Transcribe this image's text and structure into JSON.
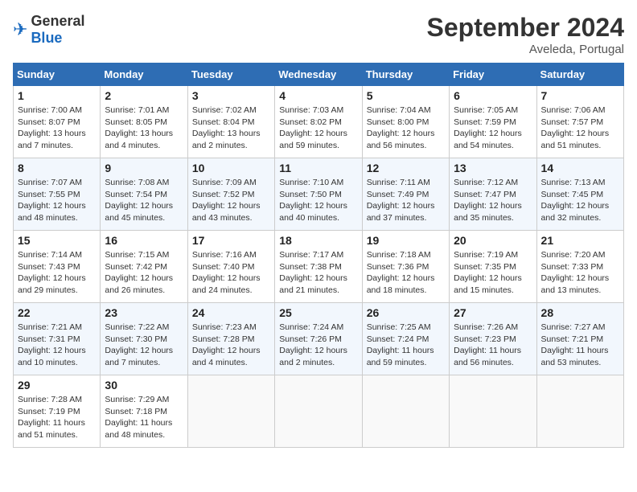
{
  "header": {
    "logo_general": "General",
    "logo_blue": "Blue",
    "month_title": "September 2024",
    "subtitle": "Aveleda, Portugal"
  },
  "days_of_week": [
    "Sunday",
    "Monday",
    "Tuesday",
    "Wednesday",
    "Thursday",
    "Friday",
    "Saturday"
  ],
  "weeks": [
    [
      {
        "day": "1",
        "sunrise": "Sunrise: 7:00 AM",
        "sunset": "Sunset: 8:07 PM",
        "daylight": "Daylight: 13 hours and 7 minutes."
      },
      {
        "day": "2",
        "sunrise": "Sunrise: 7:01 AM",
        "sunset": "Sunset: 8:05 PM",
        "daylight": "Daylight: 13 hours and 4 minutes."
      },
      {
        "day": "3",
        "sunrise": "Sunrise: 7:02 AM",
        "sunset": "Sunset: 8:04 PM",
        "daylight": "Daylight: 13 hours and 2 minutes."
      },
      {
        "day": "4",
        "sunrise": "Sunrise: 7:03 AM",
        "sunset": "Sunset: 8:02 PM",
        "daylight": "Daylight: 12 hours and 59 minutes."
      },
      {
        "day": "5",
        "sunrise": "Sunrise: 7:04 AM",
        "sunset": "Sunset: 8:00 PM",
        "daylight": "Daylight: 12 hours and 56 minutes."
      },
      {
        "day": "6",
        "sunrise": "Sunrise: 7:05 AM",
        "sunset": "Sunset: 7:59 PM",
        "daylight": "Daylight: 12 hours and 54 minutes."
      },
      {
        "day": "7",
        "sunrise": "Sunrise: 7:06 AM",
        "sunset": "Sunset: 7:57 PM",
        "daylight": "Daylight: 12 hours and 51 minutes."
      }
    ],
    [
      {
        "day": "8",
        "sunrise": "Sunrise: 7:07 AM",
        "sunset": "Sunset: 7:55 PM",
        "daylight": "Daylight: 12 hours and 48 minutes."
      },
      {
        "day": "9",
        "sunrise": "Sunrise: 7:08 AM",
        "sunset": "Sunset: 7:54 PM",
        "daylight": "Daylight: 12 hours and 45 minutes."
      },
      {
        "day": "10",
        "sunrise": "Sunrise: 7:09 AM",
        "sunset": "Sunset: 7:52 PM",
        "daylight": "Daylight: 12 hours and 43 minutes."
      },
      {
        "day": "11",
        "sunrise": "Sunrise: 7:10 AM",
        "sunset": "Sunset: 7:50 PM",
        "daylight": "Daylight: 12 hours and 40 minutes."
      },
      {
        "day": "12",
        "sunrise": "Sunrise: 7:11 AM",
        "sunset": "Sunset: 7:49 PM",
        "daylight": "Daylight: 12 hours and 37 minutes."
      },
      {
        "day": "13",
        "sunrise": "Sunrise: 7:12 AM",
        "sunset": "Sunset: 7:47 PM",
        "daylight": "Daylight: 12 hours and 35 minutes."
      },
      {
        "day": "14",
        "sunrise": "Sunrise: 7:13 AM",
        "sunset": "Sunset: 7:45 PM",
        "daylight": "Daylight: 12 hours and 32 minutes."
      }
    ],
    [
      {
        "day": "15",
        "sunrise": "Sunrise: 7:14 AM",
        "sunset": "Sunset: 7:43 PM",
        "daylight": "Daylight: 12 hours and 29 minutes."
      },
      {
        "day": "16",
        "sunrise": "Sunrise: 7:15 AM",
        "sunset": "Sunset: 7:42 PM",
        "daylight": "Daylight: 12 hours and 26 minutes."
      },
      {
        "day": "17",
        "sunrise": "Sunrise: 7:16 AM",
        "sunset": "Sunset: 7:40 PM",
        "daylight": "Daylight: 12 hours and 24 minutes."
      },
      {
        "day": "18",
        "sunrise": "Sunrise: 7:17 AM",
        "sunset": "Sunset: 7:38 PM",
        "daylight": "Daylight: 12 hours and 21 minutes."
      },
      {
        "day": "19",
        "sunrise": "Sunrise: 7:18 AM",
        "sunset": "Sunset: 7:36 PM",
        "daylight": "Daylight: 12 hours and 18 minutes."
      },
      {
        "day": "20",
        "sunrise": "Sunrise: 7:19 AM",
        "sunset": "Sunset: 7:35 PM",
        "daylight": "Daylight: 12 hours and 15 minutes."
      },
      {
        "day": "21",
        "sunrise": "Sunrise: 7:20 AM",
        "sunset": "Sunset: 7:33 PM",
        "daylight": "Daylight: 12 hours and 13 minutes."
      }
    ],
    [
      {
        "day": "22",
        "sunrise": "Sunrise: 7:21 AM",
        "sunset": "Sunset: 7:31 PM",
        "daylight": "Daylight: 12 hours and 10 minutes."
      },
      {
        "day": "23",
        "sunrise": "Sunrise: 7:22 AM",
        "sunset": "Sunset: 7:30 PM",
        "daylight": "Daylight: 12 hours and 7 minutes."
      },
      {
        "day": "24",
        "sunrise": "Sunrise: 7:23 AM",
        "sunset": "Sunset: 7:28 PM",
        "daylight": "Daylight: 12 hours and 4 minutes."
      },
      {
        "day": "25",
        "sunrise": "Sunrise: 7:24 AM",
        "sunset": "Sunset: 7:26 PM",
        "daylight": "Daylight: 12 hours and 2 minutes."
      },
      {
        "day": "26",
        "sunrise": "Sunrise: 7:25 AM",
        "sunset": "Sunset: 7:24 PM",
        "daylight": "Daylight: 11 hours and 59 minutes."
      },
      {
        "day": "27",
        "sunrise": "Sunrise: 7:26 AM",
        "sunset": "Sunset: 7:23 PM",
        "daylight": "Daylight: 11 hours and 56 minutes."
      },
      {
        "day": "28",
        "sunrise": "Sunrise: 7:27 AM",
        "sunset": "Sunset: 7:21 PM",
        "daylight": "Daylight: 11 hours and 53 minutes."
      }
    ],
    [
      {
        "day": "29",
        "sunrise": "Sunrise: 7:28 AM",
        "sunset": "Sunset: 7:19 PM",
        "daylight": "Daylight: 11 hours and 51 minutes."
      },
      {
        "day": "30",
        "sunrise": "Sunrise: 7:29 AM",
        "sunset": "Sunset: 7:18 PM",
        "daylight": "Daylight: 11 hours and 48 minutes."
      },
      null,
      null,
      null,
      null,
      null
    ]
  ]
}
